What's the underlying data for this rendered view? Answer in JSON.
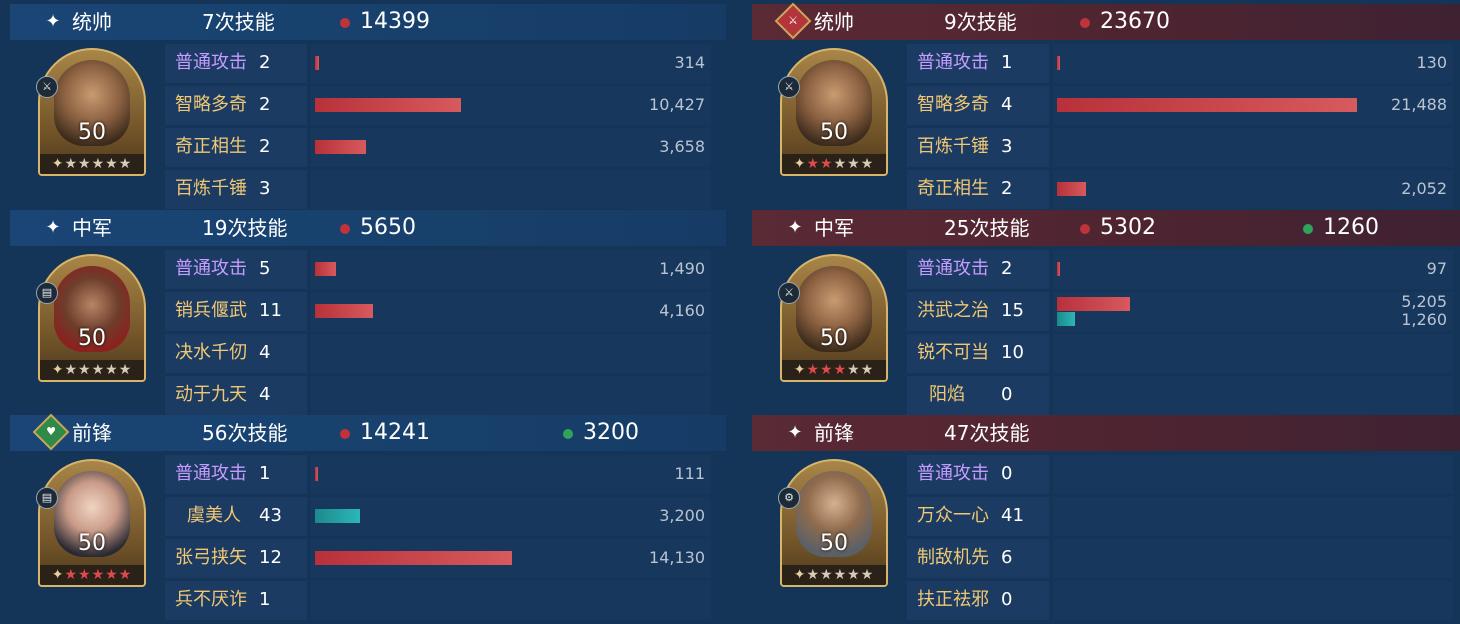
{
  "left": {
    "sections": [
      {
        "role": "统帅",
        "casts": "7次技能",
        "damage": "14399",
        "heal": "",
        "level": "50",
        "stars_on": 0,
        "skills": [
          {
            "name": "普通攻击",
            "count": "2",
            "dmg": "314",
            "heal": "",
            "dmg_frac": 0.012,
            "heal_frac": 0
          },
          {
            "name": "智略多奇",
            "count": "2",
            "dmg": "10,427",
            "heal": "",
            "dmg_frac": 0.485,
            "heal_frac": 0
          },
          {
            "name": "奇正相生",
            "count": "2",
            "dmg": "3,658",
            "heal": "",
            "dmg_frac": 0.17,
            "heal_frac": 0
          },
          {
            "name": "百炼千锤",
            "count": "3",
            "dmg": "",
            "heal": "",
            "dmg_frac": 0,
            "heal_frac": 0
          }
        ]
      },
      {
        "role": "中军",
        "casts": "19次技能",
        "damage": "5650",
        "heal": "",
        "level": "50",
        "stars_on": 0,
        "skills": [
          {
            "name": "普通攻击",
            "count": "5",
            "dmg": "1,490",
            "heal": "",
            "dmg_frac": 0.07,
            "heal_frac": 0
          },
          {
            "name": "销兵偃武",
            "count": "11",
            "dmg": "4,160",
            "heal": "",
            "dmg_frac": 0.194,
            "heal_frac": 0
          },
          {
            "name": "决水千仞",
            "count": "4",
            "dmg": "",
            "heal": "",
            "dmg_frac": 0,
            "heal_frac": 0
          },
          {
            "name": "动于九天",
            "count": "4",
            "dmg": "",
            "heal": "",
            "dmg_frac": 0,
            "heal_frac": 0
          }
        ]
      },
      {
        "role": "前锋",
        "casts": "56次技能",
        "damage": "14241",
        "heal": "3200",
        "level": "50",
        "stars_on": 5,
        "skills": [
          {
            "name": "普通攻击",
            "count": "1",
            "dmg": "111",
            "heal": "",
            "dmg_frac": 0.004,
            "heal_frac": 0
          },
          {
            "name": "虞美人",
            "count": "43",
            "dmg": "",
            "heal": "3,200",
            "dmg_frac": 0,
            "heal_frac": 0.149
          },
          {
            "name": "张弓挟矢",
            "count": "12",
            "dmg": "14,130",
            "heal": "",
            "dmg_frac": 0.658,
            "heal_frac": 0
          },
          {
            "name": "兵不厌诈",
            "count": "1",
            "dmg": "",
            "heal": "",
            "dmg_frac": 0,
            "heal_frac": 0
          }
        ]
      }
    ]
  },
  "right": {
    "sections": [
      {
        "role": "统帅",
        "casts": "9次技能",
        "damage": "23670",
        "heal": "",
        "level": "50",
        "stars_on": 2,
        "skills": [
          {
            "name": "普通攻击",
            "count": "1",
            "dmg": "130",
            "heal": "",
            "dmg_frac": 0.006,
            "heal_frac": 0
          },
          {
            "name": "智略多奇",
            "count": "4",
            "dmg": "21,488",
            "heal": "",
            "dmg_frac": 1.0,
            "heal_frac": 0
          },
          {
            "name": "百炼千锤",
            "count": "3",
            "dmg": "",
            "heal": "",
            "dmg_frac": 0,
            "heal_frac": 0
          },
          {
            "name": "奇正相生",
            "count": "2",
            "dmg": "2,052",
            "heal": "",
            "dmg_frac": 0.095,
            "heal_frac": 0
          }
        ]
      },
      {
        "role": "中军",
        "casts": "25次技能",
        "damage": "5302",
        "heal": "1260",
        "level": "50",
        "stars_on": 3,
        "skills": [
          {
            "name": "普通攻击",
            "count": "2",
            "dmg": "97",
            "heal": "",
            "dmg_frac": 0.005,
            "heal_frac": 0
          },
          {
            "name": "洪武之治",
            "count": "15",
            "dmg": "5,205",
            "heal": "1,260",
            "dmg_frac": 0.242,
            "heal_frac": 0.059
          },
          {
            "name": "锐不可当",
            "count": "10",
            "dmg": "",
            "heal": "",
            "dmg_frac": 0,
            "heal_frac": 0
          },
          {
            "name": "阳焰",
            "count": "0",
            "dmg": "",
            "heal": "",
            "dmg_frac": 0,
            "heal_frac": 0
          }
        ]
      },
      {
        "role": "前锋",
        "casts": "47次技能",
        "damage": "",
        "heal": "",
        "level": "50",
        "stars_on": 0,
        "skills": [
          {
            "name": "普通攻击",
            "count": "0",
            "dmg": "",
            "heal": "",
            "dmg_frac": 0,
            "heal_frac": 0
          },
          {
            "name": "万众一心",
            "count": "41",
            "dmg": "",
            "heal": "",
            "dmg_frac": 0,
            "heal_frac": 0
          },
          {
            "name": "制敌机先",
            "count": "6",
            "dmg": "",
            "heal": "",
            "dmg_frac": 0,
            "heal_frac": 0
          },
          {
            "name": "扶正祛邪",
            "count": "0",
            "dmg": "",
            "heal": "",
            "dmg_frac": 0,
            "heal_frac": 0
          }
        ]
      }
    ]
  },
  "colors": {
    "damage": "#c23339",
    "heal": "#2fa35c",
    "basic_attack": "#c59cff",
    "skill": "#f0c773"
  }
}
